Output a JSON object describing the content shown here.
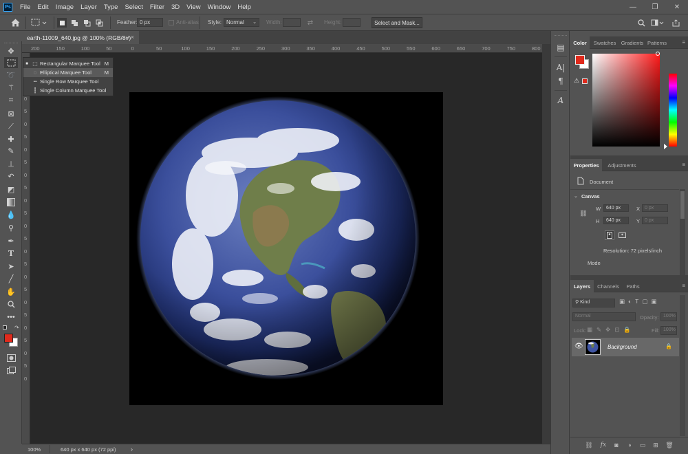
{
  "app": {
    "logo_text": "Ps"
  },
  "menu": [
    "File",
    "Edit",
    "Image",
    "Layer",
    "Type",
    "Select",
    "Filter",
    "3D",
    "View",
    "Window",
    "Help"
  ],
  "window_controls": {
    "minimize": "—",
    "restore": "❐",
    "close": "✕"
  },
  "options_bar": {
    "feather_label": "Feather:",
    "feather_value": "0 px",
    "anti_alias_label": "Anti-alias",
    "style_label": "Style:",
    "style_value": "Normal",
    "width_label": "Width:",
    "height_label": "Height:",
    "select_mask_label": "Select and Mask..."
  },
  "document": {
    "tab_title": "earth-11009_640.jpg @ 100% (RGB/8#)",
    "close": "×"
  },
  "rulers": {
    "horizontal": [
      "200",
      "150",
      "100",
      "50",
      "0",
      "50",
      "100",
      "150",
      "200",
      "250",
      "300",
      "350",
      "400",
      "450",
      "500",
      "550",
      "600",
      "650",
      "700",
      "750",
      "800"
    ],
    "vertical": [
      "5",
      "0",
      "5",
      "0",
      "5",
      "0",
      "5",
      "0",
      "5",
      "0",
      "5",
      "0",
      "5",
      "0",
      "5",
      "0",
      "5",
      "0",
      "5",
      "0",
      "5",
      "0",
      "5",
      "0",
      "5",
      "0"
    ]
  },
  "flyout": {
    "items": [
      {
        "label": "Rectangular Marquee Tool",
        "shortcut": "M",
        "active": true
      },
      {
        "label": "Elliptical Marquee Tool",
        "shortcut": "M",
        "active": false
      },
      {
        "label": "Single Row Marquee Tool",
        "shortcut": "",
        "active": false
      },
      {
        "label": "Single Column Marquee Tool",
        "shortcut": "",
        "active": false
      }
    ]
  },
  "status": {
    "zoom": "100%",
    "info": "640 px x 640 px (72 ppi)",
    "arrow": "›"
  },
  "color_panel": {
    "tabs": [
      "Color",
      "Swatches",
      "Gradients",
      "Patterns"
    ],
    "active_tab": "Color",
    "foreground": "#e02a1c",
    "background": "#ffffff",
    "hue": "#ff1a1a"
  },
  "properties_panel": {
    "tabs": [
      "Properties",
      "Adjustments"
    ],
    "doc_label": "Document",
    "section": "Canvas",
    "w_label": "W",
    "w_value": "640 px",
    "h_label": "H",
    "h_value": "640 px",
    "x_label": "X",
    "x_value": "0 px",
    "y_label": "Y",
    "y_value": "0 px",
    "resolution": "Resolution: 72 pixels/inch",
    "mode_label": "Mode"
  },
  "layers_panel": {
    "tabs": [
      "Layers",
      "Channels",
      "Paths"
    ],
    "kind_placeholder": "Kind",
    "blend_mode": "Normal",
    "opacity_label": "Opacity:",
    "opacity_value": "100%",
    "lock_label": "Lock:",
    "fill_label": "Fill:",
    "fill_value": "100%",
    "layers": [
      {
        "name": "Background",
        "visible": true,
        "locked": true
      }
    ]
  }
}
